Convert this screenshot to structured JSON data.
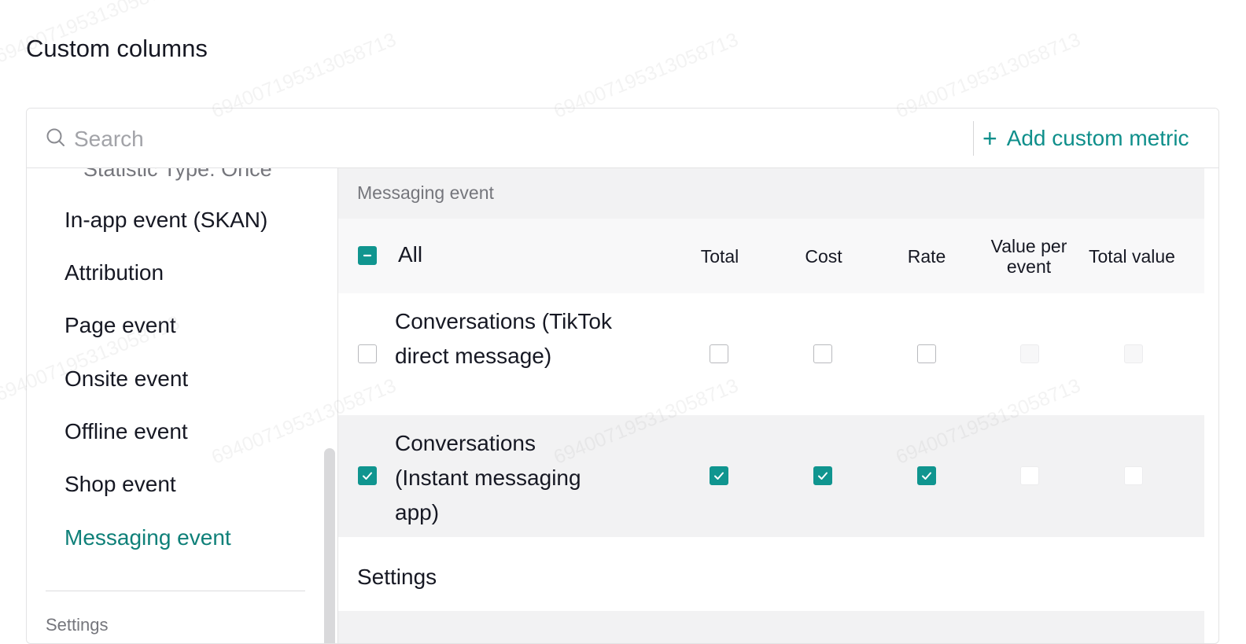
{
  "page": {
    "title": "Custom columns"
  },
  "search": {
    "placeholder": "Search",
    "value": ""
  },
  "toolbar": {
    "add_custom_metric": "Add custom metric",
    "add_icon": "plus-icon"
  },
  "sidebar": {
    "clipped_item": "Statistic Type: Once",
    "items": [
      {
        "label": "In-app event (SKAN)",
        "active": false
      },
      {
        "label": "Attribution",
        "active": false
      },
      {
        "label": "Page event",
        "active": false
      },
      {
        "label": "Onsite event",
        "active": false
      },
      {
        "label": "Offline event",
        "active": false
      },
      {
        "label": "Shop event",
        "active": false
      },
      {
        "label": "Messaging event",
        "active": true
      }
    ],
    "section_label": "Settings"
  },
  "main": {
    "section_title": "Messaging event",
    "all_label": "All",
    "all_state": "indeterminate",
    "columns": [
      "Total",
      "Cost",
      "Rate",
      "Value per event",
      "Total value"
    ],
    "rows": [
      {
        "label": "Conversations (TikTok direct message)",
        "checked": false,
        "cells": [
          "unchecked",
          "unchecked",
          "unchecked",
          "disabled",
          "disabled"
        ]
      },
      {
        "label": "Conversations (Instant messaging app)",
        "checked": true,
        "cells": [
          "checked",
          "checked",
          "checked",
          "disabled",
          "disabled"
        ]
      }
    ],
    "settings_title": "Settings"
  },
  "watermark": {
    "text": "694007195313058713"
  },
  "colors": {
    "accent": "#10958f",
    "active_nav": "#0f8079",
    "muted": "#75767c"
  }
}
